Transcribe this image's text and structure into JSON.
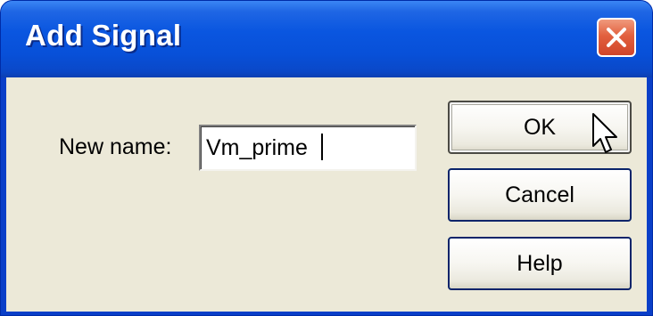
{
  "window": {
    "title": "Add Signal"
  },
  "form": {
    "name_label": "New name:",
    "name_value": "Vm_prime"
  },
  "buttons": {
    "ok": "OK",
    "cancel": "Cancel",
    "help": "Help"
  },
  "icons": {
    "close": "close-icon",
    "cursor": "mouse-pointer-icon"
  },
  "colors": {
    "titlebar": "#0a56e0",
    "close_button": "#e2603e",
    "dialog_background": "#ece9d8"
  }
}
